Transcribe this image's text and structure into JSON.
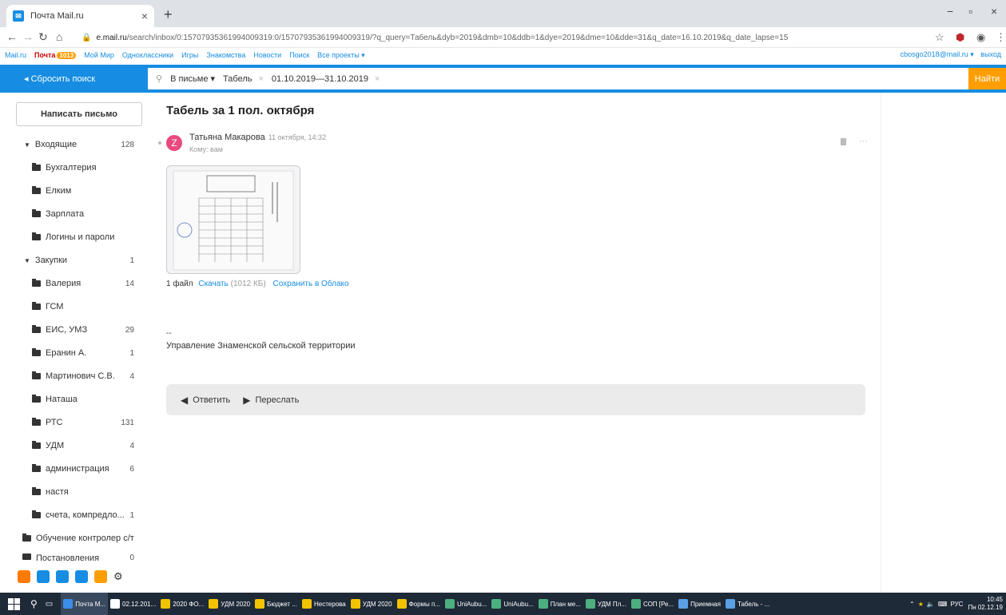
{
  "browser": {
    "tab_title": "Почта Mail.ru",
    "favicon": "✉",
    "tab_close": "×",
    "new_tab": "+",
    "url_host": "e.mail.ru",
    "url_rest": "/search/inbox/0:15707935361994009319:0/15707935361994009319/?q_query=Табель&dyb=2019&dmb=10&ddb=1&dye=2019&dme=10&dde=31&q_date=16.10.2019&q_date_lapse=15"
  },
  "portal": {
    "links": [
      "Mail.ru",
      "Почта",
      "Мой Мир",
      "Одноклассники",
      "Игры",
      "Знакомства",
      "Новости",
      "Поиск",
      "Все проекты ▾"
    ],
    "mail_badge": "1013",
    "user": "cbosgo2018@mail.ru ▾",
    "logout": "выход"
  },
  "search": {
    "reset_label": "◂  Сбросить поиск",
    "scope": "В письме ▾",
    "query": "Табель",
    "date_range": "01.10.2019—31.10.2019",
    "chip_close": "×",
    "find_label": "Найти"
  },
  "sidebar": {
    "compose_label": "Написать письмо",
    "folders": [
      {
        "label": "Входящие",
        "count": "128",
        "arrow": "▼"
      },
      {
        "label": "Бухгалтерия",
        "count": ""
      },
      {
        "label": "Елким",
        "count": ""
      },
      {
        "label": "Зарплата",
        "count": ""
      },
      {
        "label": "Логины и пароли",
        "count": ""
      },
      {
        "label": "Закупки",
        "count": "1",
        "arrow": "▼"
      },
      {
        "label": "Валерия",
        "count": "14"
      },
      {
        "label": "ГСМ",
        "count": ""
      },
      {
        "label": "ЕИС, УМЗ",
        "count": "29"
      },
      {
        "label": "Еранин А.",
        "count": "1"
      },
      {
        "label": "Мартинович С.В.",
        "count": "4"
      },
      {
        "label": "Наташа",
        "count": ""
      },
      {
        "label": "РТС",
        "count": "131"
      },
      {
        "label": "УДМ",
        "count": "4"
      },
      {
        "label": "администрация",
        "count": "6"
      },
      {
        "label": "настя",
        "count": ""
      },
      {
        "label": "счета, компредло...",
        "count": "1"
      },
      {
        "label": "Обучение контролер с/т",
        "count": ""
      },
      {
        "label": "Постановления",
        "count": "0"
      }
    ],
    "bottom_icon_colors": [
      "#ff7a00",
      "#168de2",
      "#168de2",
      "#168de2",
      "#ff9e00"
    ]
  },
  "message": {
    "subject": "Табель за 1 пол. октября",
    "avatar_letter": "Z",
    "sender": "Татьяна Макарова",
    "date": "11 октября, 14:32",
    "recipient": "Кому: вам",
    "more": "···",
    "attach_count": "1 файл",
    "download": "Скачать",
    "size": "(1012 КБ)",
    "save_cloud": "Сохранить в Облако",
    "sig_dash": "--",
    "signature": "Управление Знаменской сельской территории",
    "reply_label": "Ответить",
    "forward_label": "Переслать"
  },
  "taskbar": {
    "items": [
      {
        "label": "Почта M...",
        "color": "#3b8eea",
        "active": true
      },
      {
        "label": "02.12.201...",
        "color": "#ffffff"
      },
      {
        "label": "2020 ФО...",
        "color": "#f2c300"
      },
      {
        "label": "УДМ 2020",
        "color": "#f2c300"
      },
      {
        "label": "Бюджет ...",
        "color": "#f2c300"
      },
      {
        "label": "Нестерова",
        "color": "#f2c300"
      },
      {
        "label": "УДМ 2020",
        "color": "#f2c300"
      },
      {
        "label": "Формы п...",
        "color": "#f2c300"
      },
      {
        "label": "UniAubu...",
        "color": "#4caf80"
      },
      {
        "label": "UniAubu...",
        "color": "#4caf80"
      },
      {
        "label": "План ме...",
        "color": "#4caf80"
      },
      {
        "label": "УДМ Пл...",
        "color": "#4caf80"
      },
      {
        "label": "СОП [Ре...",
        "color": "#4caf80"
      },
      {
        "label": "Приемная",
        "color": "#5aa0e6"
      },
      {
        "label": "Табель - ...",
        "color": "#5aa0e6"
      }
    ],
    "lang": "РУС",
    "time": "10:45",
    "date": "Пн 02.12.19"
  }
}
